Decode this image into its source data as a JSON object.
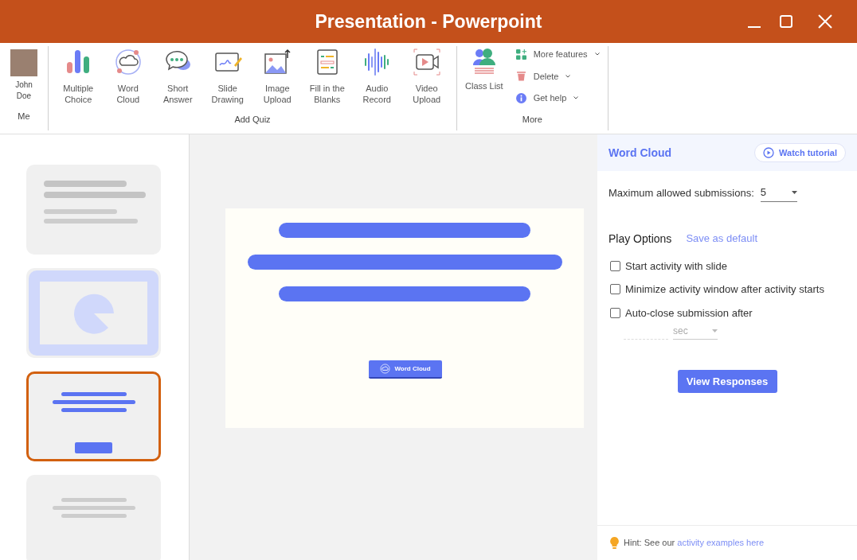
{
  "window": {
    "title": "Presentation - Powerpoint"
  },
  "ribbon": {
    "user": {
      "name": "John Doe",
      "group_label": "Me"
    },
    "add_quiz": {
      "label": "Add Quiz",
      "items": [
        "Multiple Choice",
        "Word Cloud",
        "Short Answer",
        "Slide Drawing",
        "Image Upload",
        "Fill in the Blanks",
        "Audio Record",
        "Video Upload"
      ]
    },
    "more": {
      "label": "More",
      "class_list": "Class List",
      "menu": [
        "More features",
        "Delete",
        "Get help"
      ]
    }
  },
  "slides": [
    {
      "kind": "text",
      "selected": false
    },
    {
      "kind": "chart",
      "selected": false
    },
    {
      "kind": "quiz",
      "selected": true
    },
    {
      "kind": "centered",
      "selected": false
    }
  ],
  "canvas": {
    "button": "Word Cloud"
  },
  "panel": {
    "title": "Word Cloud",
    "tutorial": "Watch tutorial",
    "max_label": "Maximum allowed submissions:",
    "max_value": "5",
    "play_options": "Play Options",
    "save_default": "Save as default",
    "options": [
      {
        "label": "Start activity with slide",
        "checked": false
      },
      {
        "label": "Minimize activity window after activity starts",
        "checked": false
      },
      {
        "label": "Auto-close submission after",
        "checked": false
      }
    ],
    "unit": "sec",
    "view_button": "View Responses",
    "hint": "Hint: See our",
    "hint_link": "activity examples here"
  }
}
